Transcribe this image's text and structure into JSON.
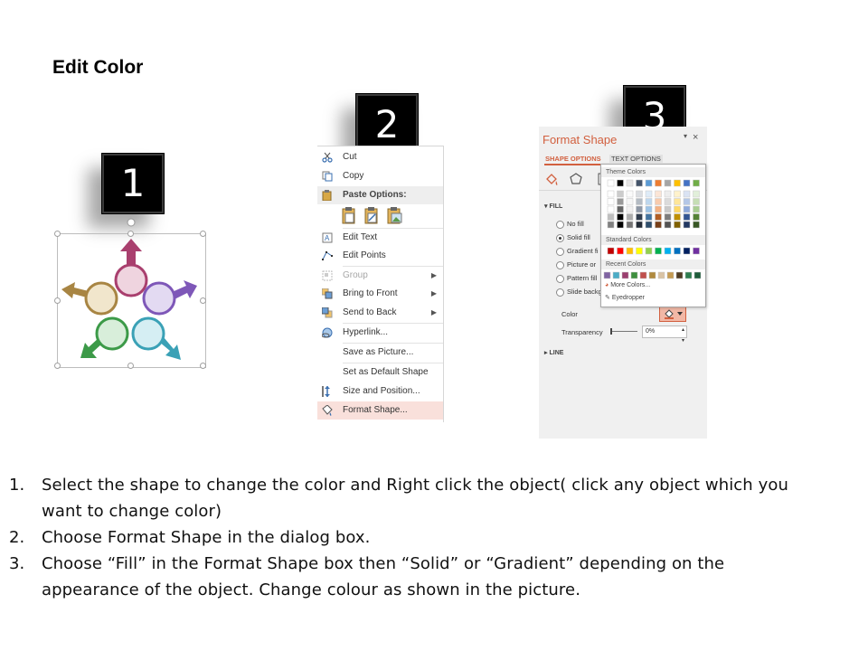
{
  "page": {
    "title": "Edit Color"
  },
  "badges": [
    "1",
    "2",
    "3"
  ],
  "context_menu": {
    "items": [
      {
        "label": "Cut",
        "icon": "scissors-icon",
        "disabled": false,
        "submenu": false
      },
      {
        "label": "Copy",
        "icon": "copy-icon",
        "disabled": false,
        "submenu": false
      },
      {
        "label": "Paste Options:",
        "icon": "paste-icon",
        "header": true
      },
      {
        "label": "Edit Text",
        "icon": "edit-text-icon",
        "disabled": false,
        "submenu": false
      },
      {
        "label": "Edit Points",
        "icon": "edit-points-icon",
        "disabled": false,
        "submenu": false
      },
      {
        "label": "Group",
        "icon": "group-icon",
        "disabled": true,
        "submenu": true
      },
      {
        "label": "Bring to Front",
        "icon": "bring-to-front-icon",
        "disabled": false,
        "submenu": true
      },
      {
        "label": "Send to Back",
        "icon": "send-to-back-icon",
        "disabled": false,
        "submenu": true
      },
      {
        "label": "Hyperlink...",
        "icon": "hyperlink-icon",
        "disabled": false,
        "submenu": false
      },
      {
        "label": "Save as Picture...",
        "icon": "",
        "disabled": false,
        "submenu": false
      },
      {
        "label": "Set as Default Shape",
        "icon": "",
        "disabled": false,
        "submenu": false
      },
      {
        "label": "Size and Position...",
        "icon": "size-position-icon",
        "disabled": false,
        "submenu": false
      },
      {
        "label": "Format Shape...",
        "icon": "format-shape-icon",
        "disabled": false,
        "submenu": false,
        "highlighted": true
      }
    ]
  },
  "format_pane": {
    "title": "Format Shape",
    "close": "×",
    "pin": "▾",
    "tabs": {
      "shape_options": "SHAPE OPTIONS",
      "text_options": "TEXT OPTIONS"
    },
    "fill_section": "FILL",
    "fill_options": [
      "No fill",
      "Solid fill",
      "Gradient fill",
      "Picture or texture fill",
      "Pattern fill",
      "Slide background fill"
    ],
    "fill_labels_visible": [
      "No fill",
      "Solid fill",
      "Gradient fi",
      "Picture or",
      "Pattern fill",
      "Slide backg"
    ],
    "selected_fill": "Solid fill",
    "color_label": "Color",
    "transparency_label": "Transparency",
    "transparency_value": "0%",
    "line_section": "LINE"
  },
  "color_picker": {
    "theme_colors_label": "Theme Colors",
    "standard_colors_label": "Standard Colors",
    "recent_colors_label": "Recent Colors",
    "more_colors": "More Colors...",
    "eyedropper": "Eyedropper",
    "theme_top": [
      "#ffffff",
      "#000000",
      "#e7e6e6",
      "#44546a",
      "#5b9bd5",
      "#ed7d31",
      "#a5a5a5",
      "#ffc000",
      "#4472c4",
      "#70ad47"
    ],
    "standard": [
      "#c00000",
      "#ff0000",
      "#ffc000",
      "#ffff00",
      "#92d050",
      "#00b050",
      "#00b0f0",
      "#0070c0",
      "#002060",
      "#7030a0"
    ],
    "recent": [
      "#8064a2",
      "#4bacc6",
      "#9b3f6f",
      "#3e8f3e",
      "#c0504d",
      "#b08a3e",
      "#d9c3a5",
      "#c59b52",
      "#4f3b22",
      "#2e7d4f",
      "#1e5c3a"
    ]
  },
  "instructions": [
    {
      "num": "1.",
      "line1": "Select the shape to change the color and Right click the object( click any object which you",
      "line2": "want to change color)"
    },
    {
      "num": "2.",
      "line1": "Choose Format Shape in the dialog box.",
      "line2": ""
    },
    {
      "num": "3.",
      "line1": "Choose “Fill” in the Format Shape box then “Solid” or “Gradient” depending on the",
      "line2": "appearance of the object. Change colour as shown in the picture."
    }
  ],
  "colors": {
    "accent": "#d2603f",
    "pink": "#a93f6e",
    "purple": "#7e57b8",
    "teal": "#3aa1b6",
    "green": "#3c9a48",
    "tan": "#a88543"
  }
}
